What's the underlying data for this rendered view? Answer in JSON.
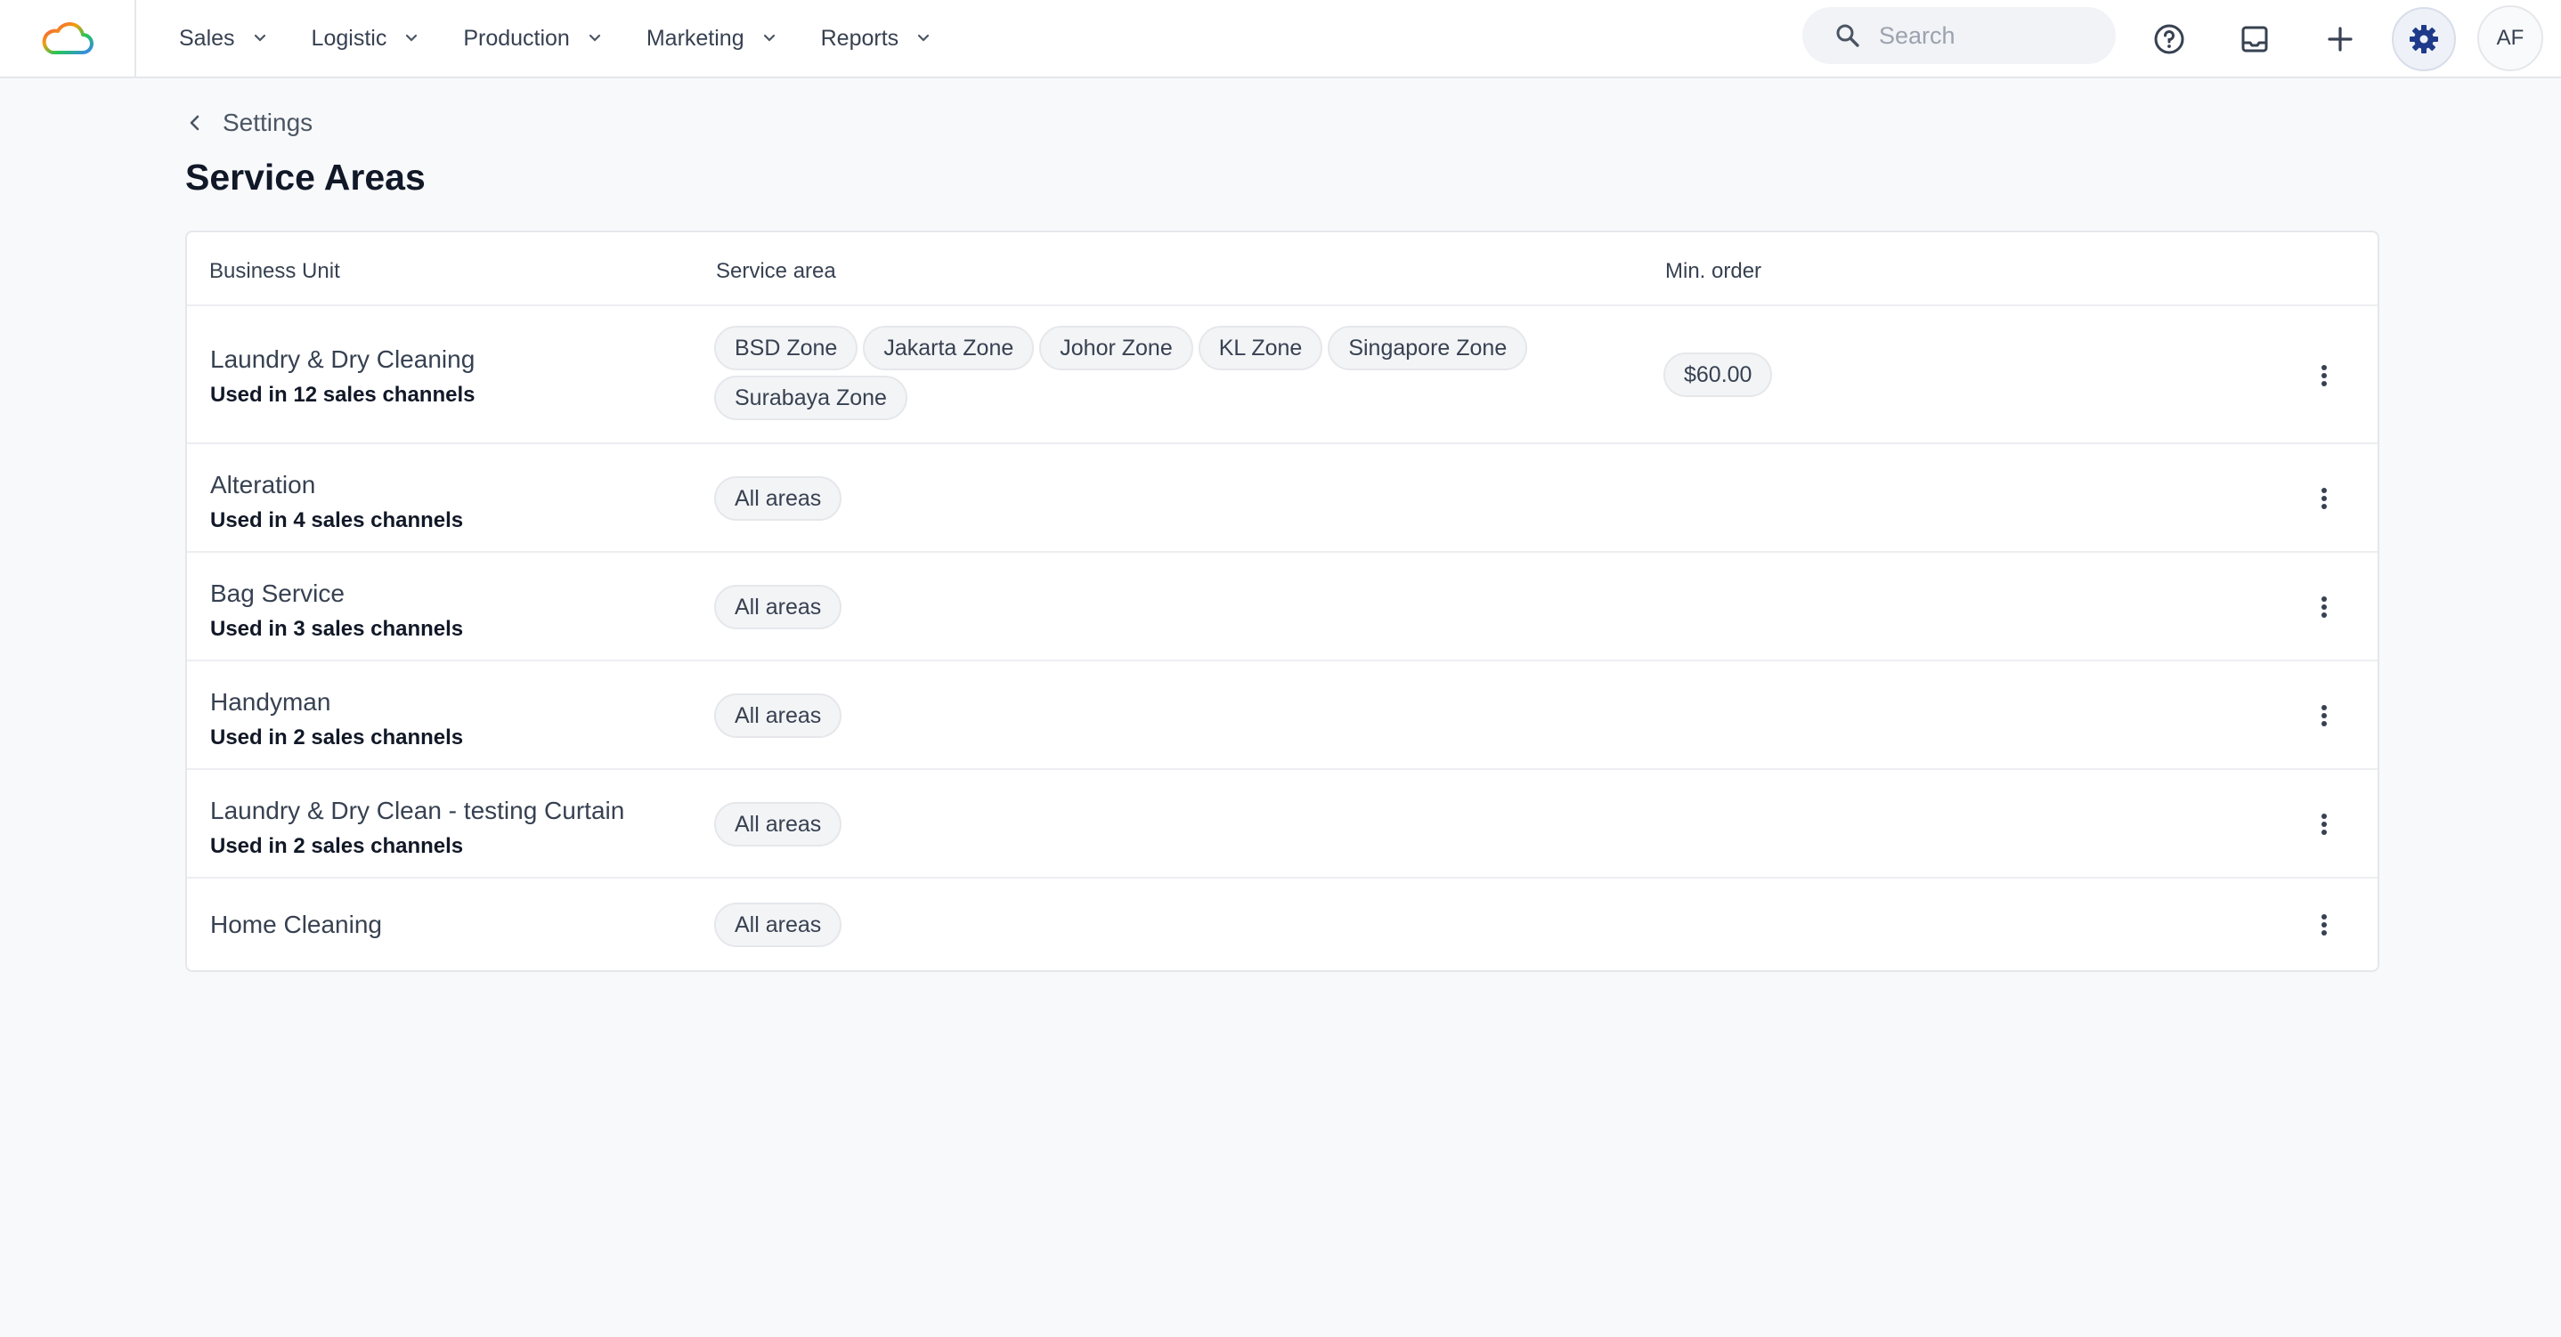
{
  "nav": {
    "items": [
      {
        "label": "Sales"
      },
      {
        "label": "Logistic"
      },
      {
        "label": "Production"
      },
      {
        "label": "Marketing"
      },
      {
        "label": "Reports"
      }
    ]
  },
  "search": {
    "placeholder": "Search",
    "icon": "search-icon"
  },
  "toolbar": {
    "icons": [
      "help-circle-icon",
      "inbox-icon",
      "plus-icon",
      "gear-icon"
    ],
    "avatar_initials": "AF",
    "gear_color": "#1f3a8a"
  },
  "breadcrumb": {
    "label": "Settings"
  },
  "page": {
    "title": "Service Areas"
  },
  "table": {
    "headers": {
      "business_unit": "Business Unit",
      "service_area": "Service area",
      "min_order": "Min. order"
    },
    "rows": [
      {
        "name": "Laundry & Dry Cleaning",
        "channels": "Used in 12 sales channels",
        "areas": [
          "BSD Zone",
          "Jakarta Zone",
          "Johor Zone",
          "KL Zone",
          "Singapore Zone",
          "Surabaya Zone"
        ],
        "min_order": "$60.00"
      },
      {
        "name": "Alteration",
        "channels": "Used in 4 sales channels",
        "areas": [
          "All areas"
        ],
        "min_order": ""
      },
      {
        "name": "Bag Service",
        "channels": "Used in 3 sales channels",
        "areas": [
          "All areas"
        ],
        "min_order": ""
      },
      {
        "name": "Handyman",
        "channels": "Used in 2 sales channels",
        "areas": [
          "All areas"
        ],
        "min_order": ""
      },
      {
        "name": "Laundry & Dry Clean - testing Curtain",
        "channels": "Used in 2 sales channels",
        "areas": [
          "All areas"
        ],
        "min_order": ""
      },
      {
        "name": "Home Cleaning",
        "channels": "",
        "areas": [
          "All areas"
        ],
        "min_order": ""
      }
    ]
  }
}
